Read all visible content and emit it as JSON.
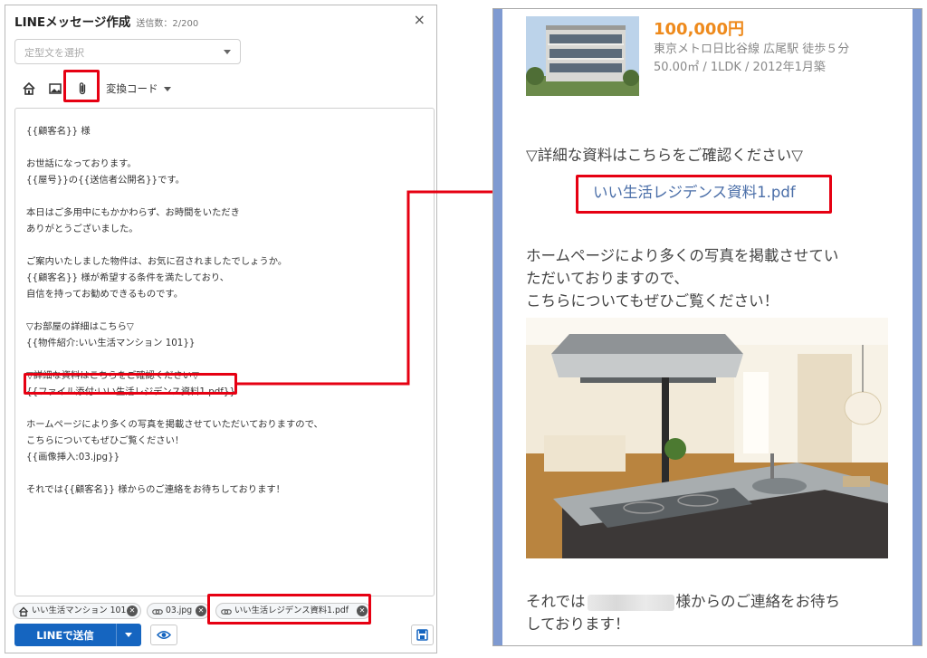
{
  "composer": {
    "title": "LINEメッセージ作成",
    "send_count": "送信数：2/200",
    "close_label": "×",
    "template_placeholder": "定型文を選択",
    "convert_code_label": "変換コード",
    "body_lines": [
      "{{顧客名}} 様",
      "お世話になっております。",
      "{{屋号}}の{{送信者公開名}}です。",
      "本日はご多用中にもかかわらず、お時間をいただき",
      "ありがとうございました。",
      "ご案内いたしました物件は、お気に召されましたでしょうか。",
      "{{顧客名}} 様が希望する条件を満たしており、",
      "自信を持ってお勧めできるものです。",
      "▽お部屋の詳細はこちら▽",
      "{{物件紹介:いい生活マンション 101}}",
      "▽詳細な資料はこちらをご確認ください▽",
      "{{ファイル添付:いい生活レジデンス資料1.pdf}}",
      "ホームページにより多くの写真を掲載させていただいておりますので、",
      "こちらについてもぜひご覧ください！",
      "{{画像挿入:03.jpg}}",
      "それでは{{顧客名}} 様からのご連絡をお待ちしております！"
    ],
    "attachments": [
      {
        "label": "いい生活マンション 101",
        "icon": "home-icon"
      },
      {
        "label": "03.jpg",
        "icon": "link-icon"
      },
      {
        "label": "いい生活レジデンス資料1.pdf",
        "icon": "link-icon"
      }
    ],
    "send_label": "LINEで送信"
  },
  "preview": {
    "price": "100,000円",
    "access": "東京メトロ日比谷線 広尾駅 徒歩５分",
    "specs": "50.00㎡ / 1LDK / 2012年1月築",
    "doc_heading": "▽詳細な資料はこちらをご確認ください▽",
    "doc_link": "いい生活レジデンス資料1.pdf",
    "hp_line1": "ホームページにより多くの写真を掲載させてい",
    "hp_line2": "ただいておりますので、",
    "hp_line3": "こちらについてもぜひご覧ください！",
    "closing_prefix": "それでは",
    "closing_suffix": "様からのご連絡をお待ち",
    "closing_line2": "しております！"
  },
  "colors": {
    "callout_red": "#e60012",
    "send_blue": "#1565c0",
    "price_orange": "#ee8a1c",
    "link_blue": "#4a6ea8",
    "preview_rail": "#7f9ad1"
  }
}
